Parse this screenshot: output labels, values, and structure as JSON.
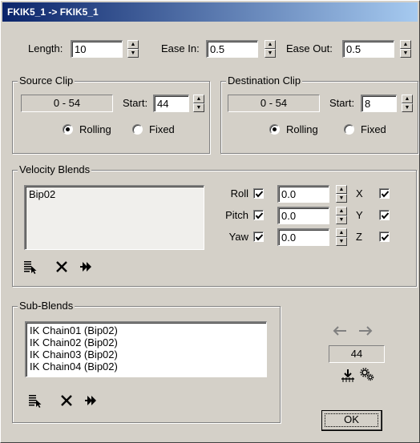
{
  "window": {
    "title": "FKIK5_1 -> FKIK5_1"
  },
  "header": {
    "length_label": "Length:",
    "length_value": "10",
    "ease_in_label": "Ease In:",
    "ease_in_value": "0.5",
    "ease_out_label": "Ease Out:",
    "ease_out_value": "0.5"
  },
  "source_clip": {
    "title": "Source Clip",
    "range": "0 - 54",
    "start_label": "Start:",
    "start_value": "44",
    "rolling_label": "Rolling",
    "fixed_label": "Fixed",
    "selected": "rolling"
  },
  "destination_clip": {
    "title": "Destination Clip",
    "range": "0 - 54",
    "start_label": "Start:",
    "start_value": "8",
    "rolling_label": "Rolling",
    "fixed_label": "Fixed",
    "selected": "rolling"
  },
  "velocity_blends": {
    "title": "Velocity Blends",
    "items": [
      "Bip02"
    ],
    "rows": [
      {
        "label": "Roll",
        "value": "0.0",
        "axis": "X",
        "checked": true,
        "axis_checked": true
      },
      {
        "label": "Pitch",
        "value": "0.0",
        "axis": "Y",
        "checked": true,
        "axis_checked": true
      },
      {
        "label": "Yaw",
        "value": "0.0",
        "axis": "Z",
        "checked": true,
        "axis_checked": true
      }
    ]
  },
  "sub_blends": {
    "title": "Sub-Blends",
    "items": [
      "IK Chain01 (Bip02)",
      "IK Chain02 (Bip02)",
      "IK Chain03 (Bip02)",
      "IK Chain04 (Bip02)"
    ]
  },
  "navigation": {
    "frame_value": "44"
  },
  "buttons": {
    "ok_label": "OK"
  },
  "icons": {
    "select_list": "select-list-icon",
    "delete": "delete-x-icon",
    "forward": "fast-forward-icon",
    "arrow_left": "arrow-left-icon",
    "arrow_right": "arrow-right-icon",
    "keyframe": "keyframe-icon",
    "gears": "gears-icon"
  },
  "colors": {
    "dialog_bg": "#d4d0c8",
    "title_start": "#0a246a",
    "title_end": "#a6caf0",
    "arrow_disabled": "#808080"
  }
}
